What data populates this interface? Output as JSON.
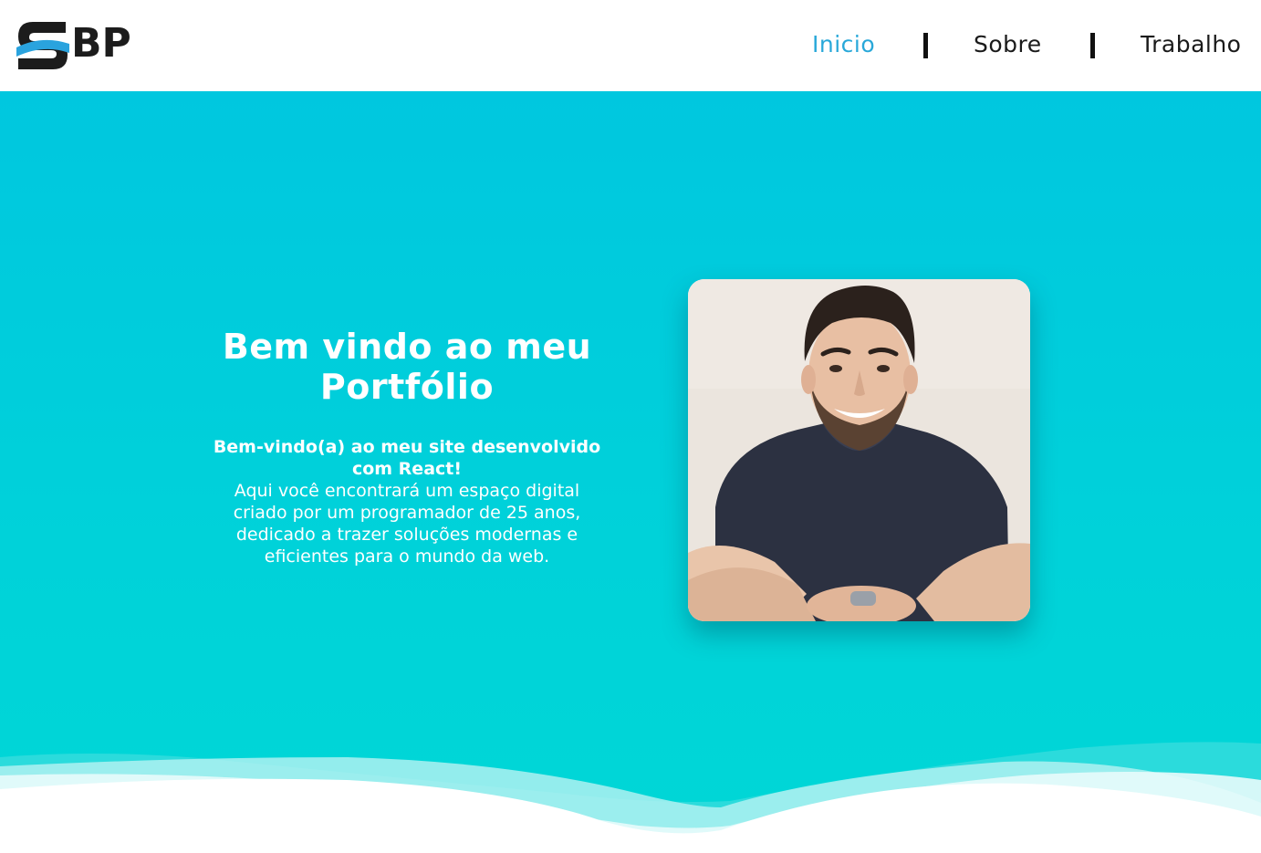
{
  "header": {
    "logo_text": "BP",
    "logo_letter": "S",
    "nav": [
      {
        "label": "Inicio",
        "active": true
      },
      {
        "label": "Sobre",
        "active": false
      },
      {
        "label": "Trabalho",
        "active": false
      }
    ]
  },
  "hero": {
    "title_line1": "Bem vindo ao meu",
    "title_line2": "Portfólio",
    "lead_line1": "Bem-vindo(a) ao meu site desenvolvido",
    "lead_line2": "com React!",
    "body_line1": "Aqui você encontrará um espaço digital",
    "body_line2": "criado por um programador de 25 anos,",
    "body_line3": "dedicado a trazer soluções modernas e",
    "body_line4": "eficientes para o mundo da web."
  },
  "colors": {
    "accent": "#29a8d9",
    "hero_top": "#00c7df",
    "hero_bottom": "#00d7d6",
    "text_dark": "#1a1a1a",
    "white": "#ffffff"
  },
  "icons": {
    "logo": "sbp-logo",
    "separator": "nav-divider"
  }
}
